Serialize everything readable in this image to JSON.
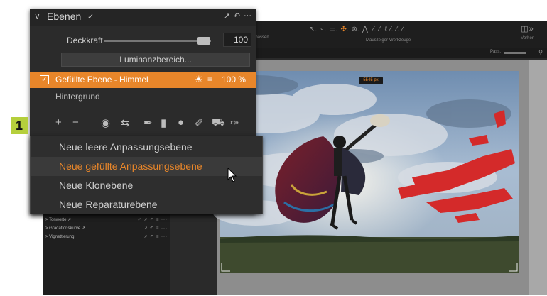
{
  "toolbar": {
    "left_label": "npassen",
    "center_label": "Mauszeiger-Werkzeuge",
    "right_label": "Vorher",
    "tool_icons": [
      "↖.",
      "∘.",
      "▭.",
      "✣.",
      "⊗.",
      "⋀.",
      "∕.",
      "∕.",
      "ℓ",
      "∕.",
      "∕.",
      "∕."
    ],
    "pass_label": "Pass."
  },
  "layers_panel": {
    "title": "Ebenen",
    "opacity_label": "Deckkraft",
    "opacity_value": "100",
    "opacity_fraction": 0.9,
    "luminance_button": "Luminanzbereich...",
    "active_layer": {
      "name": "Gefüllte Ebene - Himmel",
      "opacity": "100 %",
      "checked": true
    },
    "background_layer": "Hintergrund"
  },
  "step_badge": "1",
  "context_menu": {
    "items": [
      "Neue leere Anpassungsebene",
      "Neue gefüllte Anpassungsebene",
      "Neue Klonebene",
      "Neue Reparaturebene"
    ],
    "highlighted_index": 1
  },
  "adjustments": [
    {
      "name": "Tonwerte ↗",
      "icons": "✓ ↗ ↶ ≡ ···"
    },
    {
      "name": "Gradationskurve ↗",
      "icons": "↗ ↶ ≡ ···"
    },
    {
      "name": "Vignettierung",
      "icons": "↗ ↶ ≡ ···"
    }
  ],
  "px_badge": "5545 px",
  "colors": {
    "accent": "#e8862a",
    "step_badge": "#b5cf3c",
    "panel_bg": "#2b2b2b",
    "mask_red": "#d42a2a"
  }
}
